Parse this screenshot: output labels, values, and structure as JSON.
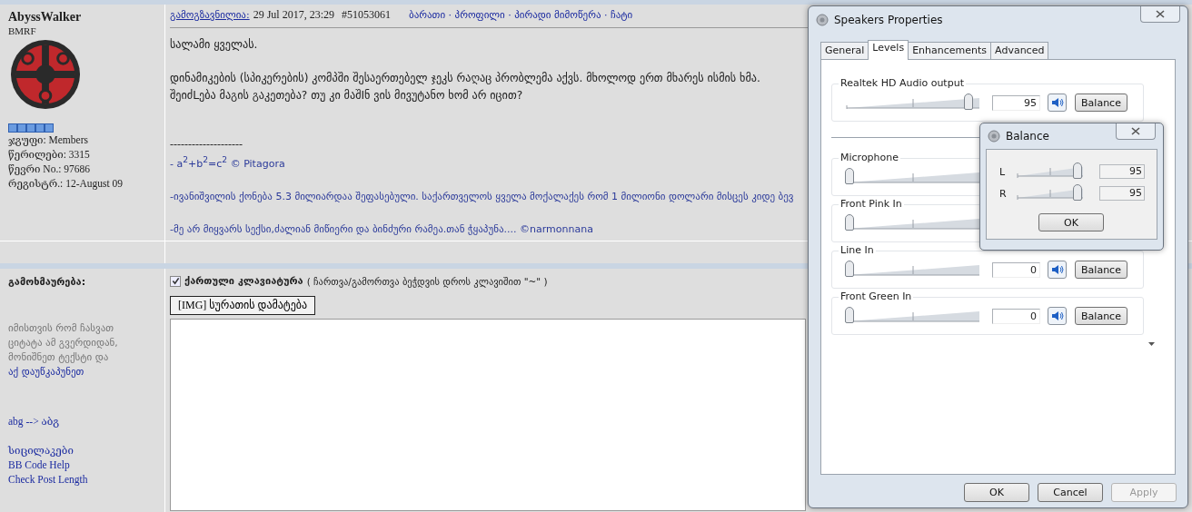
{
  "post": {
    "author": "AbyssWalker",
    "member_title": "BMRF",
    "info": [
      "ჯგუფი: Members",
      "წერილები: 3315",
      "წევრი No.: 97686",
      "რეგისტრ.: 12-August 09"
    ],
    "posted_label": "გამოგზავნილია:",
    "date": "29 Jul 2017, 23:29",
    "post_id": "#51053061",
    "links": "ბარათი · პროფილი · პირადი მიმოწერა · ჩატი",
    "body": [
      "სალამი ყველას.",
      "დინამიკების (სპიკერების) კომპში შესაერთებელ ჯეკს რაღაც პრობლემა აქვს. მხოლოდ ერთ მხარეს ისმის ხმა.",
      "შეიძLება მაგის გაკეთება? თუ კი მაშIნ ვის მივუტანო ხომ არ იცით?"
    ],
    "signature_rule": "--------------------",
    "signature": [
      "- a$^{2}$+b$^{2}$=c$^{2}$ © Pitagora",
      "-ივანიშვილის ქონება 5.3 მილიარდაა შეფასებული. საქართველოს ყველა მოქალაქეს რომ 1 მილიონი დოლარი მისცეს კიდე ბევ",
      "-მე არ მიყვარს სექსი,ძალიან მიწიერი და ბინძური რამეა.თან ჭყაპუნა.... ©narmonnana"
    ]
  },
  "reply": {
    "label": "გამოხმაურება:",
    "hint": "იმისთვის რომ ჩასვათ ციტატა ამ გვერდიდან, მონიშნეთ ტექსტი და",
    "hint_link": "აქ დაუწკაპუნეთ",
    "links": [
      "abg --> აბგ",
      "სიცილაკები",
      "BB Code Help",
      "Check Post Length"
    ],
    "keyboard": {
      "checked": true,
      "label": "ქართული კლავიატურა",
      "note": "( ჩართვა/გამორთვა ბეჭდვის დროს კლავიშით \"~\" )"
    },
    "img_button": "[IMG] სურათის დამატება"
  },
  "dialog": {
    "title": "Speakers Properties",
    "tabs": [
      {
        "label": "General",
        "selected": false
      },
      {
        "label": "Levels",
        "selected": true
      },
      {
        "label": "Enhancements",
        "selected": false
      },
      {
        "label": "Advanced",
        "selected": false
      }
    ],
    "devices": [
      {
        "kind": "output",
        "name": "Realtek HD Audio output",
        "level": 0.95,
        "value": "95",
        "balance": "Balance"
      },
      {
        "kind": "input",
        "name": "Microphone",
        "level": 0
      },
      {
        "kind": "input",
        "name": "Front Pink In",
        "level": 0
      },
      {
        "kind": "input",
        "name": "Line In",
        "level": 0,
        "value": "0",
        "balance": "Balance"
      },
      {
        "kind": "input",
        "name": "Front Green In",
        "level": 0,
        "value": "0",
        "balance": "Balance"
      }
    ],
    "buttons": [
      {
        "label": "OK",
        "disabled": false
      },
      {
        "label": "Cancel",
        "disabled": false
      },
      {
        "label": "Apply",
        "disabled": true
      }
    ]
  },
  "balance": {
    "title": "Balance",
    "channels": [
      {
        "name": "L",
        "level": 0.95,
        "value": "95"
      },
      {
        "name": "R",
        "level": 0.95,
        "value": "95"
      }
    ],
    "ok": "OK"
  }
}
